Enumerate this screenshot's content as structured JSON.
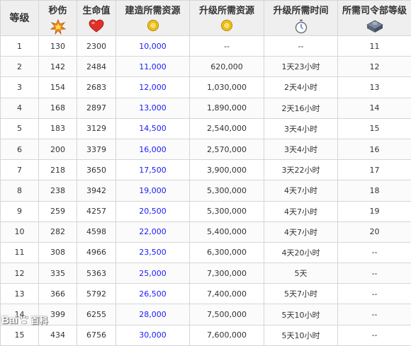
{
  "columns": [
    {
      "label": "等级",
      "icon": ""
    },
    {
      "label": "秒伤",
      "icon": "explosion-icon"
    },
    {
      "label": "生命值",
      "icon": "heart-icon"
    },
    {
      "label": "建造所需资源",
      "icon": "gold-coin-icon"
    },
    {
      "label": "升级所需资源",
      "icon": "gold-coin-icon"
    },
    {
      "label": "升级所需时间",
      "icon": "stopwatch-icon"
    },
    {
      "label": "所需司令部等级",
      "icon": "headquarters-icon"
    }
  ],
  "rows": [
    [
      "1",
      "130",
      "2300",
      "10,000",
      "--",
      "--",
      "11"
    ],
    [
      "2",
      "142",
      "2484",
      "11,000",
      "620,000",
      "1天23小时",
      "12"
    ],
    [
      "3",
      "154",
      "2683",
      "12,000",
      "1,030,000",
      "2天4小时",
      "13"
    ],
    [
      "4",
      "168",
      "2897",
      "13,000",
      "1,890,000",
      "2天16小时",
      "14"
    ],
    [
      "5",
      "183",
      "3129",
      "14,500",
      "2,540,000",
      "3天4小时",
      "15"
    ],
    [
      "6",
      "200",
      "3379",
      "16,000",
      "2,570,000",
      "3天4小时",
      "16"
    ],
    [
      "7",
      "218",
      "3650",
      "17,500",
      "3,900,000",
      "3天22小时",
      "17"
    ],
    [
      "8",
      "238",
      "3942",
      "19,000",
      "5,300,000",
      "4天7小时",
      "18"
    ],
    [
      "9",
      "259",
      "4257",
      "20,500",
      "5,300,000",
      "4天7小时",
      "19"
    ],
    [
      "10",
      "282",
      "4598",
      "22,000",
      "5,400,000",
      "4天7小时",
      "20"
    ],
    [
      "11",
      "308",
      "4966",
      "23,500",
      "6,300,000",
      "4天20小时",
      "--"
    ],
    [
      "12",
      "335",
      "5363",
      "25,000",
      "7,300,000",
      "5天",
      "--"
    ],
    [
      "13",
      "366",
      "5792",
      "26,500",
      "7,400,000",
      "5天7小时",
      "--"
    ],
    [
      "14",
      "399",
      "6255",
      "28,000",
      "7,500,000",
      "5天10小时",
      "--"
    ],
    [
      "15",
      "434",
      "6756",
      "30,000",
      "7,600,000",
      "5天10小时",
      "--"
    ]
  ],
  "colors": {
    "build_cost_text": "#1a1aff",
    "header_bg": "#efefef",
    "border": "#d6d6d6",
    "body_text": "#333333"
  },
  "watermark": {
    "prefix": "Bai",
    "mid": "百科",
    "icon": "baidu-paw-icon"
  }
}
